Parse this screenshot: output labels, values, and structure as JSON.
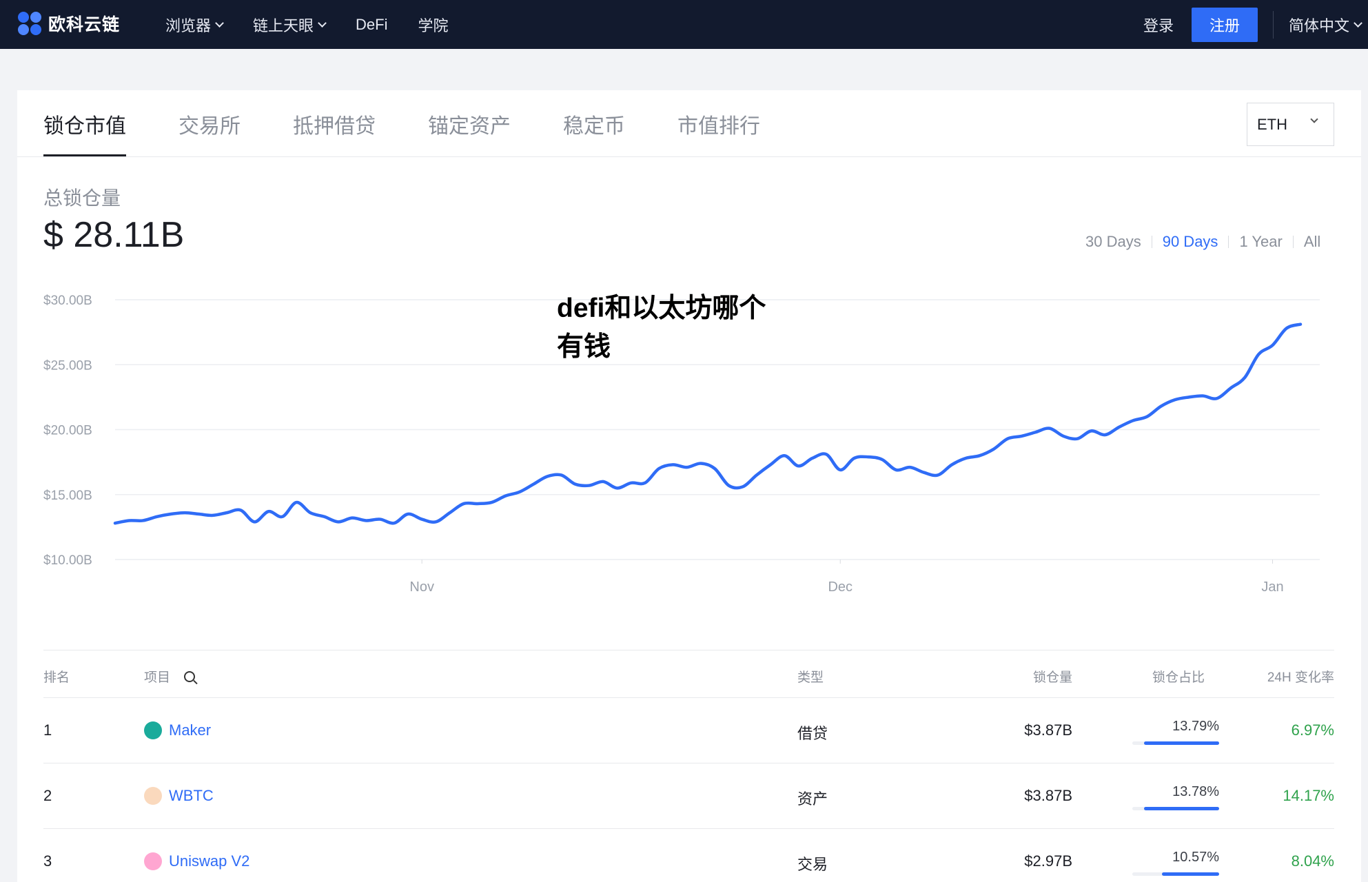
{
  "brand": {
    "name": "欧科云链"
  },
  "nav": {
    "items": [
      {
        "label": "浏览器",
        "dropdown": true
      },
      {
        "label": "链上天眼",
        "dropdown": true
      },
      {
        "label": "DeFi",
        "dropdown": false
      },
      {
        "label": "学院",
        "dropdown": false
      }
    ],
    "login": "登录",
    "register": "注册",
    "language": "简体中文"
  },
  "tabs": [
    "锁仓市值",
    "交易所",
    "抵押借贷",
    "锚定资产",
    "稳定币",
    "市值排行"
  ],
  "currency_select": "ETH",
  "summary": {
    "label": "总锁仓量",
    "value": "$ 28.11B"
  },
  "ranges": [
    {
      "label": "30 Days",
      "active": false
    },
    {
      "label": "90 Days",
      "active": true
    },
    {
      "label": "1 Year",
      "active": false
    },
    {
      "label": "All",
      "active": false
    }
  ],
  "watermark": "defi和以太坊哪个有钱",
  "chart_data": {
    "type": "line",
    "title": "",
    "xlabel": "",
    "ylabel": "",
    "ylim": [
      10,
      30
    ],
    "yticks": [
      "$30.00B",
      "$25.00B",
      "$20.00B",
      "$15.00B",
      "$10.00B"
    ],
    "ytick_values": [
      30,
      25,
      20,
      15,
      10
    ],
    "xticks": [
      {
        "label": "Nov",
        "index": 22
      },
      {
        "label": "Dec",
        "index": 52
      },
      {
        "label": "Jan",
        "index": 83
      }
    ],
    "grid": true,
    "color": "#2f6cf6",
    "series": [
      {
        "values": [
          12.8,
          13.0,
          13.0,
          13.3,
          13.5,
          13.6,
          13.5,
          13.4,
          13.6,
          13.8,
          12.9,
          13.7,
          13.3,
          14.4,
          13.6,
          13.3,
          12.9,
          13.2,
          13.0,
          13.1,
          12.8,
          13.5,
          13.1,
          12.9,
          13.6,
          14.3,
          14.3,
          14.4,
          14.9,
          15.2,
          15.8,
          16.4,
          16.5,
          15.8,
          15.7,
          16.0,
          15.5,
          15.9,
          15.9,
          17.0,
          17.3,
          17.1,
          17.4,
          17.0,
          15.7,
          15.6,
          16.5,
          17.3,
          18.0,
          17.2,
          17.8,
          18.1,
          16.9,
          17.8,
          17.9,
          17.7,
          16.9,
          17.1,
          16.7,
          16.5,
          17.3,
          17.8,
          18.0,
          18.5,
          19.3,
          19.5,
          19.8,
          20.1,
          19.5,
          19.3,
          19.9,
          19.6,
          20.2,
          20.7,
          21.0,
          21.8,
          22.3,
          22.5,
          22.6,
          22.4,
          23.2,
          24.0,
          25.8,
          26.5,
          27.8,
          28.11
        ]
      }
    ]
  },
  "table": {
    "headers": {
      "rank": "排名",
      "project": "项目",
      "type": "类型",
      "tvl": "锁仓量",
      "share": "锁仓占比",
      "change": "24H 变化率"
    },
    "rows": [
      {
        "rank": "1",
        "name": "Maker",
        "icon": "maker-icon",
        "icon_color": "#1aab9b",
        "type": "借贷",
        "tvl": "$3.87B",
        "share": "13.79%",
        "share_value": 0.1379,
        "change": "6.97%"
      },
      {
        "rank": "2",
        "name": "WBTC",
        "icon": "wbtc-icon",
        "icon_color": "#f09242",
        "type": "资产",
        "tvl": "$3.87B",
        "share": "13.78%",
        "share_value": 0.1378,
        "change": "14.17%"
      },
      {
        "rank": "3",
        "name": "Uniswap V2",
        "icon": "uniswap-icon",
        "icon_color": "#ff007a",
        "type": "交易",
        "tvl": "$2.97B",
        "share": "10.57%",
        "share_value": 0.1057,
        "change": "8.04%"
      }
    ]
  }
}
